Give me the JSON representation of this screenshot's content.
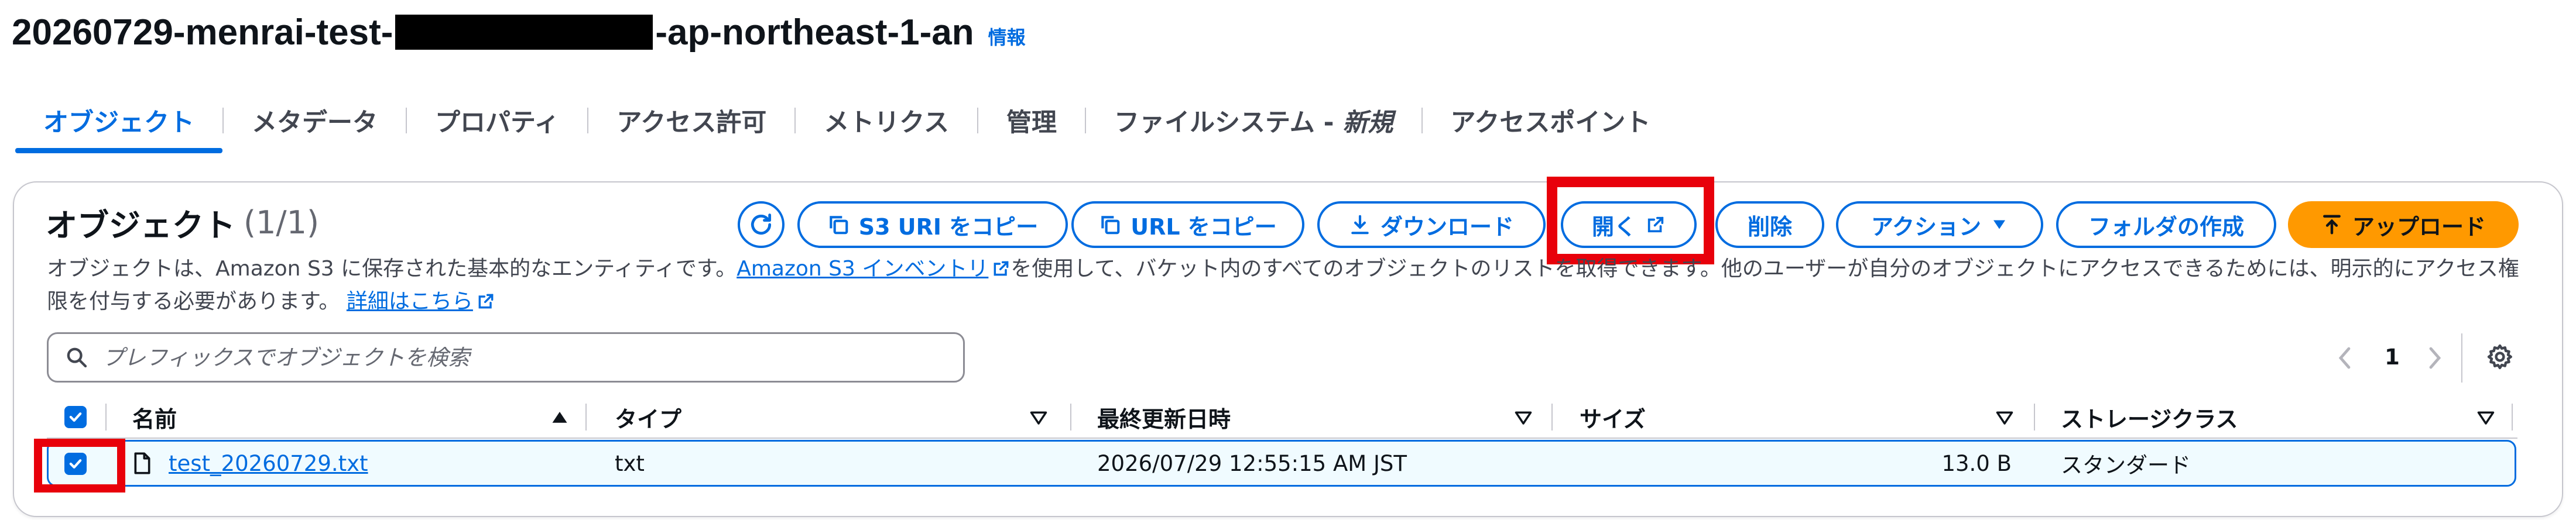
{
  "header": {
    "bucket_prefix": "20260729-menrai-test-",
    "bucket_suffix": "-ap-northeast-1-an",
    "info_link": "情報"
  },
  "tabs": [
    {
      "label": "オブジェクト",
      "active": true
    },
    {
      "label": "メタデータ"
    },
    {
      "label": "プロパティ"
    },
    {
      "label": "アクセス許可"
    },
    {
      "label": "メトリクス"
    },
    {
      "label": "管理"
    },
    {
      "label": "ファイルシステム - ",
      "label_suffix": "新規"
    },
    {
      "label": "アクセスポイント"
    }
  ],
  "objects_panel": {
    "title": "オブジェクト",
    "count": "(1/1)",
    "buttons": {
      "copy_s3_uri": "S3 URI をコピー",
      "copy_url": "URL をコピー",
      "download": "ダウンロード",
      "open": "開く",
      "delete": "削除",
      "actions": "アクション",
      "create_folder": "フォルダの作成",
      "upload": "アップロード"
    },
    "description": {
      "part1": "オブジェクトは、Amazon S3 に保存された基本的なエンティティです。",
      "inventory_link": "Amazon S3 インベントリ",
      "part2": "を使用して、バケット内のすべてのオブジェクトのリストを取得できます。他のユーザーが自分のオブジェクトにアクセスできるためには、明示的にアクセス権限を付与する必要があります。",
      "details_link": "詳細はこちら"
    },
    "search": {
      "placeholder": "プレフィックスでオブジェクトを検索"
    },
    "pagination": {
      "current_page": "1"
    },
    "table": {
      "columns": {
        "name": "名前",
        "type": "タイプ",
        "last_modified": "最終更新日時",
        "size": "サイズ",
        "storage_class": "ストレージクラス"
      },
      "rows": [
        {
          "selected": true,
          "name": "test_20260729.txt",
          "type": "txt",
          "last_modified": "2026/07/29 12:55:15 AM JST",
          "size": "13.0 B",
          "storage_class": "スタンダード"
        }
      ]
    }
  },
  "colors": {
    "accent": "#006ce0",
    "primary_button": "#ff9900",
    "highlight": "#e8000b"
  }
}
